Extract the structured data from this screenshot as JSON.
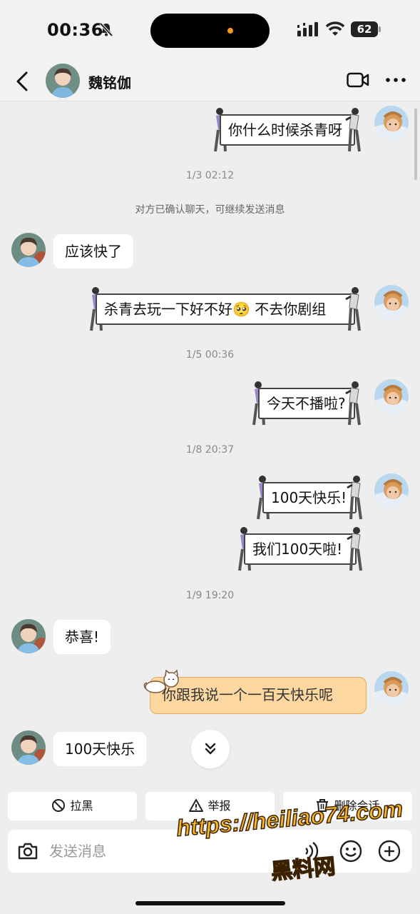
{
  "status_bar": {
    "time": "00:36",
    "battery": "62"
  },
  "header": {
    "contact_name": "魏铭伽"
  },
  "messages": [
    {
      "text": "你什么时候杀青呀"
    },
    {
      "timestamp": "1/3 02:12"
    },
    {
      "system": "对方已确认聊天，可继续发送消息"
    },
    {
      "text": "应该快了"
    },
    {
      "text": "杀青去玩一下好不好🥺 不去你剧组"
    },
    {
      "timestamp": "1/5 00:36"
    },
    {
      "text": "今天不播啦?"
    },
    {
      "timestamp": "1/8 20:37"
    },
    {
      "text": "100天快乐!"
    },
    {
      "text": "我们100天啦!"
    },
    {
      "timestamp": "1/9 19:20"
    },
    {
      "text": "恭喜!"
    },
    {
      "text": "你跟我说一个一百天快乐呢"
    },
    {
      "text": "100天快乐"
    }
  ],
  "actions": {
    "block": "拉黑",
    "report": "举报",
    "delete": "删除会话"
  },
  "input": {
    "placeholder": "发送消息"
  },
  "watermark": {
    "line1": "https://heiliao74.com",
    "line2": "黑料网"
  },
  "colors": {
    "background": "#eeeeee",
    "orange_bubble": "#fcd8a0",
    "watermark": "#f7b52a"
  },
  "icons": [
    "bell-mute-icon",
    "signal-icon",
    "wifi-icon",
    "battery-icon",
    "back-icon",
    "video-call-icon",
    "more-icon",
    "chevron-double-down-icon",
    "block-icon",
    "warning-icon",
    "trash-icon",
    "camera-icon",
    "voice-icon",
    "emoji-icon",
    "plus-icon",
    "cat-sticker-icon"
  ]
}
